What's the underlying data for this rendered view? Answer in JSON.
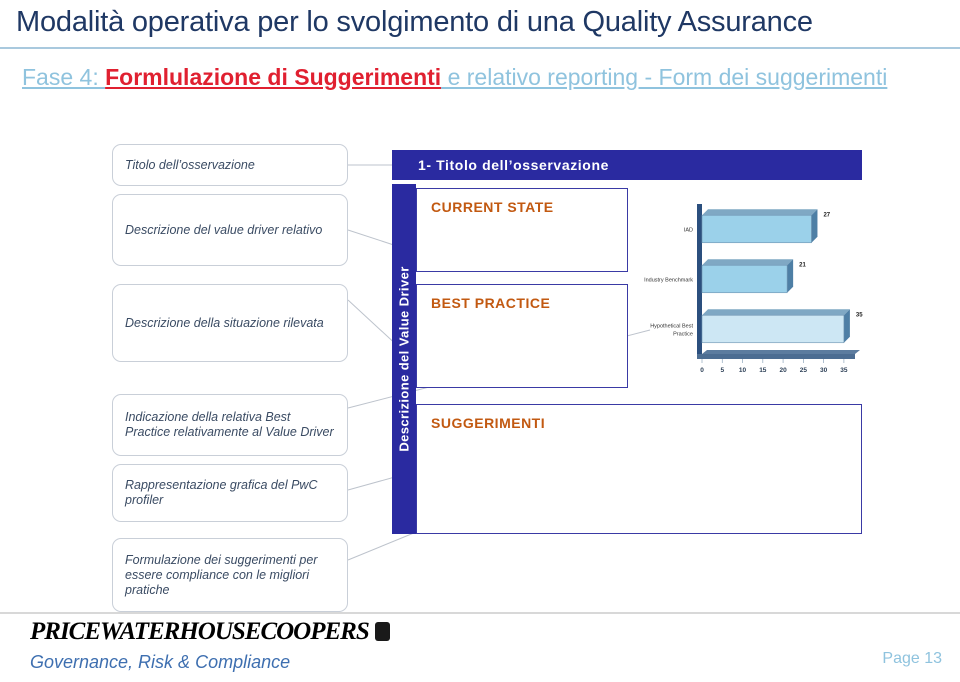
{
  "slide": {
    "title": "Modalità operativa per lo svolgimento di una Quality Assurance",
    "subtitle": {
      "prefix": "Fase 4: ",
      "highlight": "Formlulazione di Suggerimenti",
      "rest": " e relativo reporting - Form dei suggerimenti"
    }
  },
  "annotations": [
    {
      "text": "Titolo dell’osservazione"
    },
    {
      "text": "Descrizione del value driver relativo"
    },
    {
      "text": "Descrizione della situazione rilevata"
    },
    {
      "text": "Indicazione della relativa Best Practice relativamente al Value Driver"
    },
    {
      "text": "Rappresentazione grafica del PwC profiler"
    },
    {
      "text": "Formulazione dei suggerimenti per essere compliance con le migliori pratiche"
    }
  ],
  "form": {
    "header": "1- Titolo dell’osservazione",
    "vertical_band_label": "Descrizione del Value Driver",
    "panels": [
      {
        "title": "CURRENT STATE"
      },
      {
        "title": "BEST PRACTICE"
      },
      {
        "title": "SUGGERIMENTI"
      }
    ]
  },
  "chart_data": {
    "type": "bar",
    "orientation": "horizontal",
    "title": "",
    "categories": [
      "IAD",
      "Industry Benchmark",
      "Hypothetical Best Practice"
    ],
    "values": [
      27,
      21,
      35
    ],
    "data_labels": [
      "27",
      "21",
      "35"
    ],
    "xlabel": "",
    "ylabel": "",
    "xlim": [
      0,
      37
    ],
    "xticks": [
      0,
      5,
      10,
      15,
      20,
      25,
      30,
      35
    ],
    "xtick_labels": [
      "0",
      "5",
      "10",
      "15",
      "20",
      "25",
      "30",
      "35"
    ],
    "grid": false,
    "legend": false,
    "bar_colors": [
      "#9BD1EA",
      "#9BD1EA",
      "#CDE7F4"
    ],
    "axis_color": "#2B4F7E"
  },
  "footer": {
    "logo_text": "PRICEWATERHOUSECOOPERS",
    "tagline": "Governance, Risk & Compliance",
    "page": "Page 13"
  },
  "colors": {
    "title": "#1F3864",
    "accent_blue": "#2A2AA0",
    "panel_title": "#C25911",
    "light_blue": "#8FC3DE",
    "highlight_red": "#E02030"
  }
}
